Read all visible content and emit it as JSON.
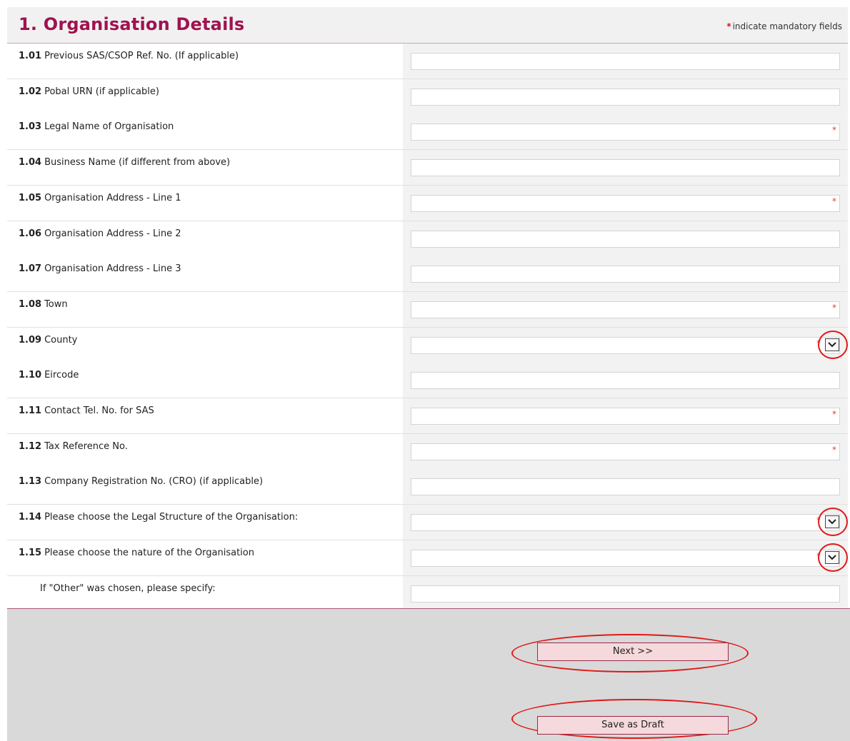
{
  "header": {
    "title": "1. Organisation Details",
    "mandatory_star": "*",
    "mandatory_note": "indicate mandatory fields"
  },
  "fields": [
    {
      "num": "1.01",
      "label": "Previous SAS/CSOP Ref. No. (If applicable)",
      "value": "",
      "required": false,
      "type": "text"
    },
    {
      "num": "1.02",
      "label": "Pobal URN (if applicable)",
      "value": "",
      "required": false,
      "type": "text"
    },
    {
      "num": "1.03",
      "label": "Legal Name of Organisation",
      "value": "",
      "required": true,
      "type": "text"
    },
    {
      "num": "1.04",
      "label": "Business Name (if different from above)",
      "value": "",
      "required": false,
      "type": "text"
    },
    {
      "num": "1.05",
      "label": "Organisation Address - Line 1",
      "value": "",
      "required": true,
      "type": "text"
    },
    {
      "num": "1.06",
      "label": "Organisation Address - Line 2",
      "value": "",
      "required": false,
      "type": "text"
    },
    {
      "num": "1.07",
      "label": "Organisation Address - Line 3",
      "value": "",
      "required": false,
      "type": "text"
    },
    {
      "num": "1.08",
      "label": "Town",
      "value": "",
      "required": true,
      "type": "text"
    },
    {
      "num": "1.09",
      "label": "County",
      "value": "",
      "required": true,
      "type": "select"
    },
    {
      "num": "1.10",
      "label": "Eircode",
      "value": "",
      "required": false,
      "type": "text"
    },
    {
      "num": "1.11",
      "label": "Contact Tel. No. for SAS",
      "value": "",
      "required": true,
      "type": "text"
    },
    {
      "num": "1.12",
      "label": "Tax Reference No.",
      "value": "",
      "required": true,
      "type": "text"
    },
    {
      "num": "1.13",
      "label": "Company Registration No. (CRO) (if applicable)",
      "value": "",
      "required": false,
      "type": "text"
    },
    {
      "num": "1.14",
      "label": "Please choose the Legal Structure of the Organisation:",
      "value": "",
      "required": true,
      "type": "select"
    },
    {
      "num": "1.15",
      "label": "Please choose the nature of the Organisation",
      "value": "",
      "required": true,
      "type": "select"
    },
    {
      "num": "",
      "label": "If \"Other\" was chosen, please specify:",
      "value": "",
      "required": false,
      "type": "text"
    }
  ],
  "required_marker": "*",
  "buttons": {
    "next": "Next >>",
    "save_draft": "Save as Draft"
  },
  "colors": {
    "title": "#a0124f",
    "required": "#e04040",
    "annotation": "#e01818",
    "button_bg": "#f6d9dc"
  },
  "icons": {
    "dropdown": "chevron-down-icon"
  }
}
